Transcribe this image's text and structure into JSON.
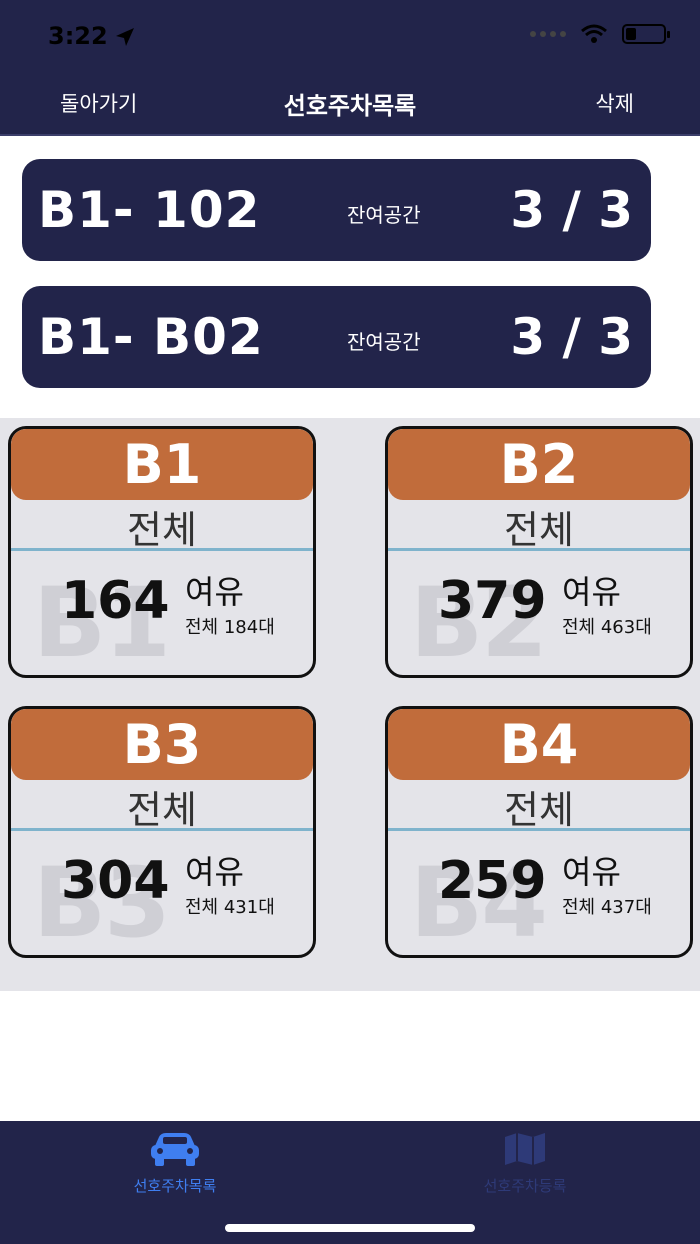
{
  "status": {
    "time": "3:22"
  },
  "nav": {
    "back": "돌아가기",
    "title": "선호주차목록",
    "delete": "삭제"
  },
  "favorites": [
    {
      "code": "B1- 102",
      "label": "잔여공간",
      "count": "3 / 3"
    },
    {
      "code": "B1- B02",
      "label": "잔여공간",
      "count": "3 / 3"
    }
  ],
  "floors": [
    {
      "name": "B1",
      "sub": "전체",
      "ghost": "B1",
      "available": "164",
      "free_label": "여유",
      "total": "전체 184대"
    },
    {
      "name": "B2",
      "sub": "전체",
      "ghost": "B2",
      "available": "379",
      "free_label": "여유",
      "total": "전체 463대"
    },
    {
      "name": "B3",
      "sub": "전체",
      "ghost": "B3",
      "available": "304",
      "free_label": "여유",
      "total": "전체 431대"
    },
    {
      "name": "B4",
      "sub": "전체",
      "ghost": "B4",
      "available": "259",
      "free_label": "여유",
      "total": "전체 437대"
    }
  ],
  "tabs": [
    {
      "label": "선호주차목록",
      "icon": "car-icon",
      "active": true
    },
    {
      "label": "선호주차등록",
      "icon": "map-icon",
      "active": false
    }
  ],
  "colors": {
    "navy": "#22244a",
    "orange": "#c16c3b",
    "active_tab": "#3f7ef0"
  }
}
